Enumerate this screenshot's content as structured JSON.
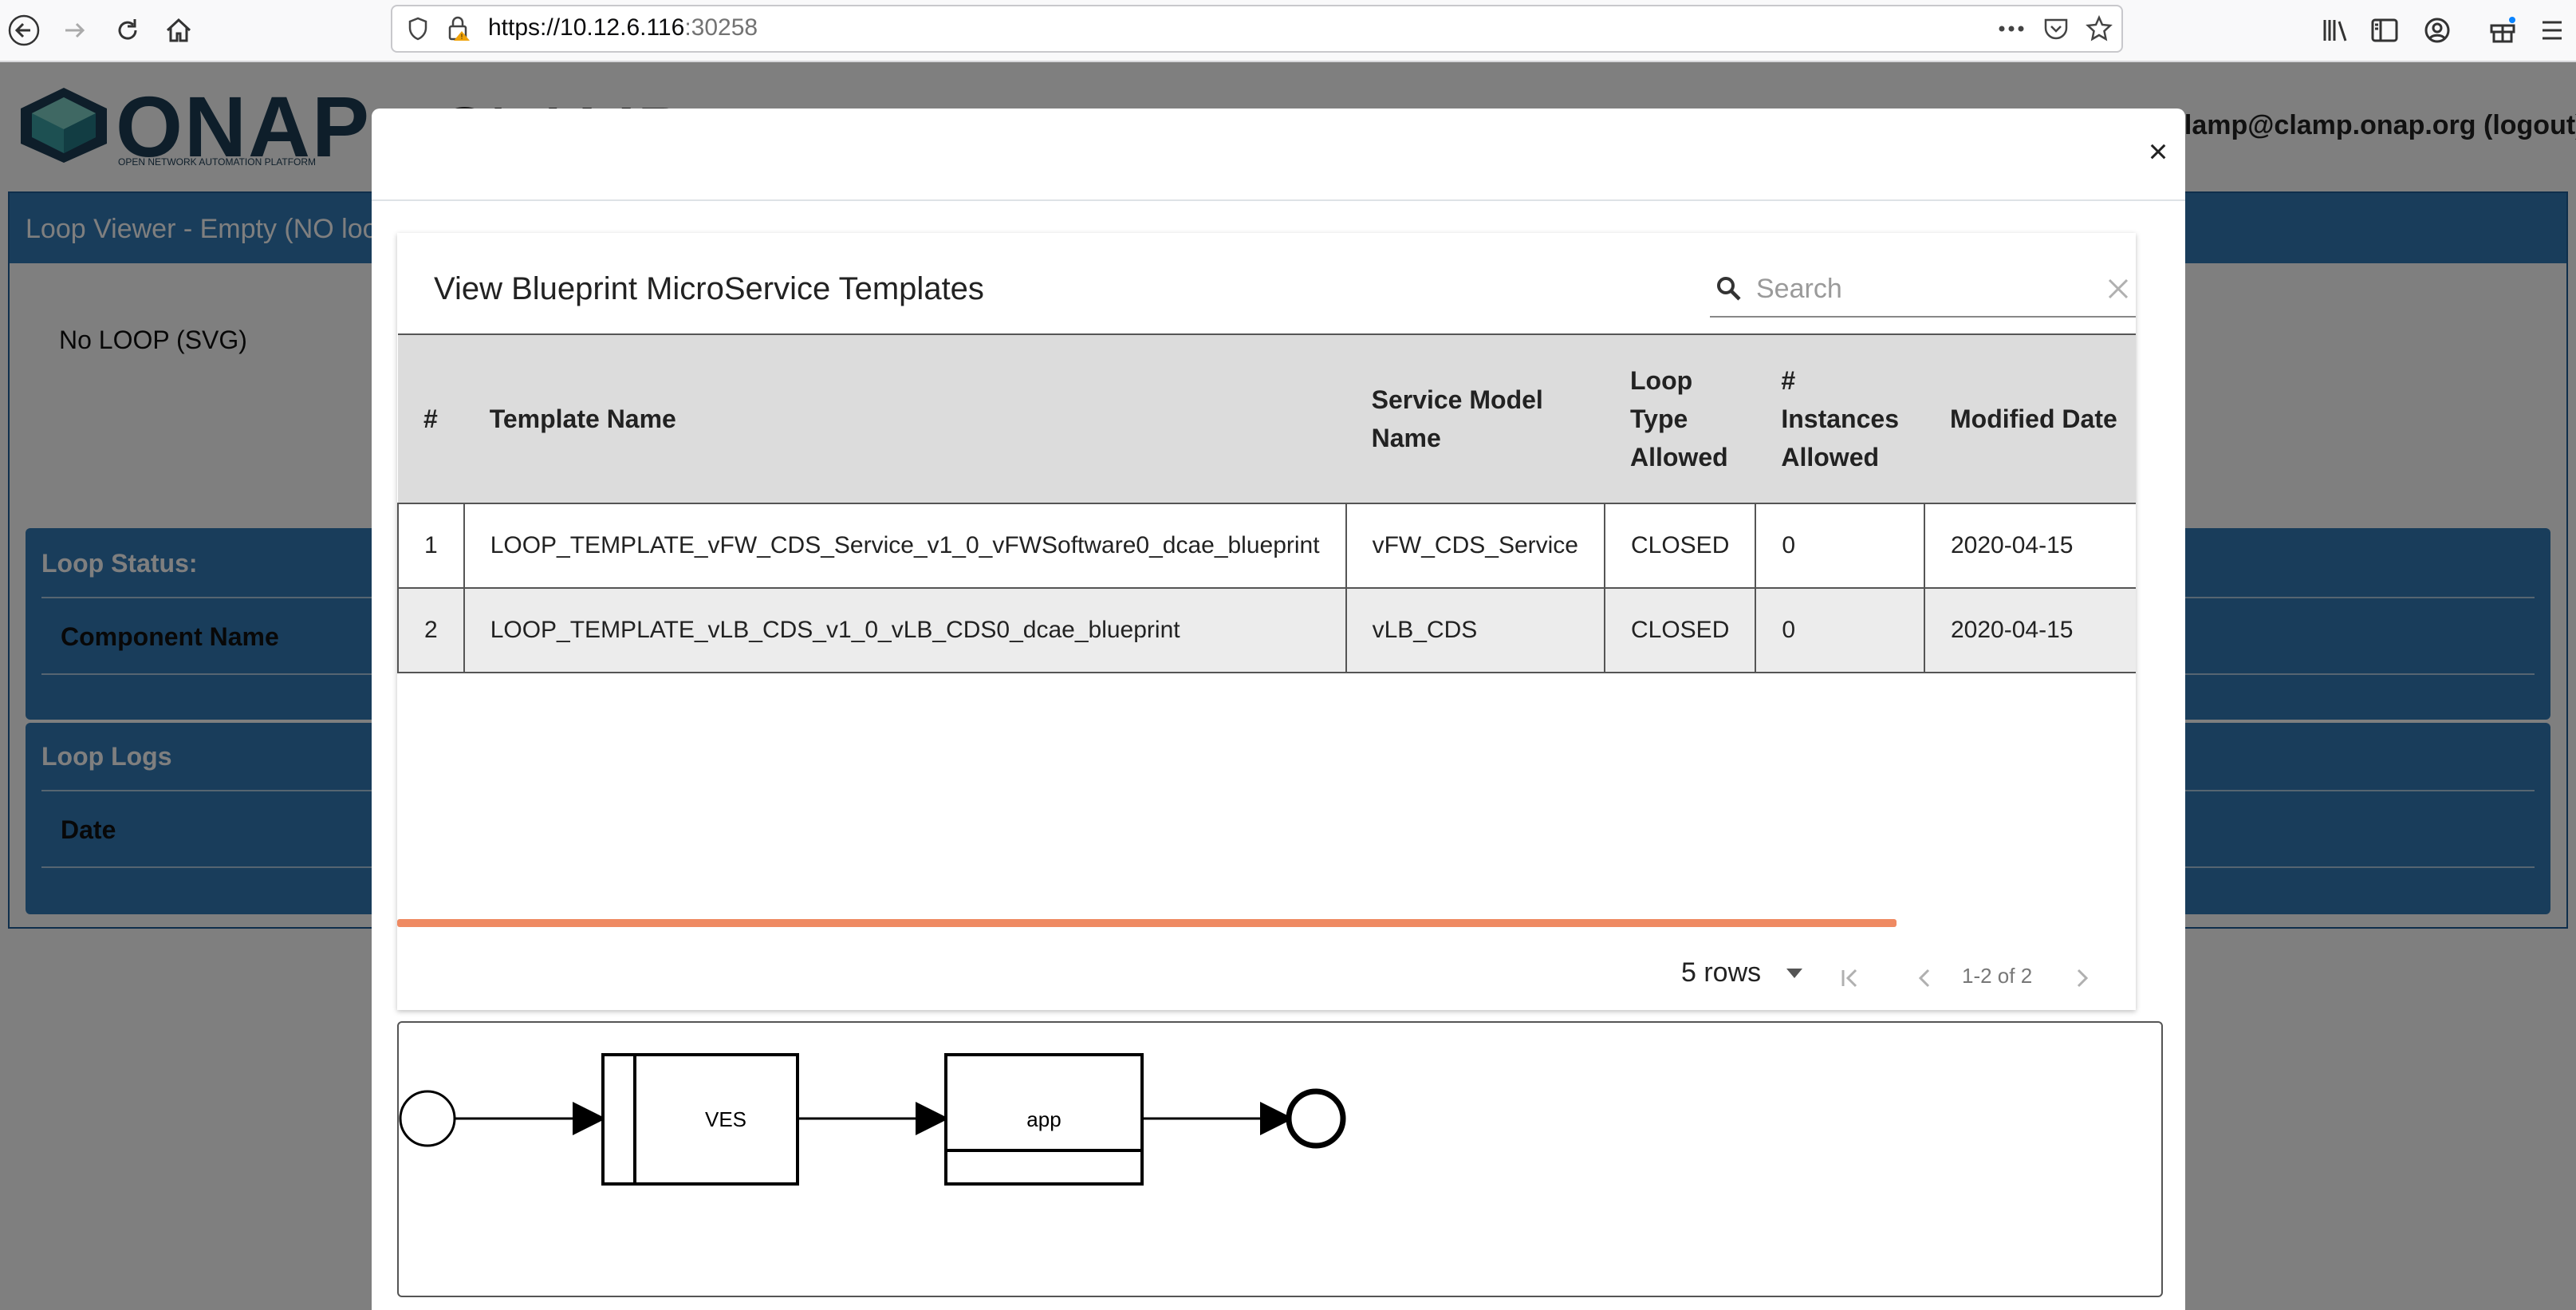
{
  "browser": {
    "url_host": "https://10.12.6.116",
    "url_port": ":30258"
  },
  "app": {
    "logo_text": "ONAP",
    "logo_subtext": "OPEN NETWORK AUTOMATION PLATFORM",
    "title": "CLAMP",
    "user": "clamp@clamp.onap.org (logout)",
    "viewer_title": "Loop Viewer - Empty (NO loop loaded yet)",
    "no_loop": "No LOOP (SVG)",
    "status_panel": {
      "title": "Loop Status:",
      "column": "Component Name"
    },
    "logs_panel": {
      "title": "Loop Logs",
      "column": "Date"
    }
  },
  "modal": {
    "close_label": "×",
    "title": "View Blueprint MicroService Templates",
    "search": {
      "placeholder": "Search"
    },
    "table": {
      "columns": [
        "#",
        "Template Name",
        "Service Model Name",
        "Loop Type Allowed",
        "# Instances Allowed",
        "Modified Date"
      ],
      "rows": [
        [
          "1",
          "LOOP_TEMPLATE_vFW_CDS_Service_v1_0_vFWSoftware0_dcae_blueprint",
          "vFW_CDS_Service",
          "CLOSED",
          "0",
          "2020-04-15"
        ],
        [
          "2",
          "LOOP_TEMPLATE_vLB_CDS_v1_0_vLB_CDS0_dcae_blueprint",
          "vLB_CDS",
          "CLOSED",
          "0",
          "2020-04-15"
        ]
      ]
    },
    "pagination": {
      "rows_label": "5 rows",
      "range": "1-2 of 2"
    },
    "diagram": {
      "box1": "VES",
      "box2": "app"
    }
  }
}
